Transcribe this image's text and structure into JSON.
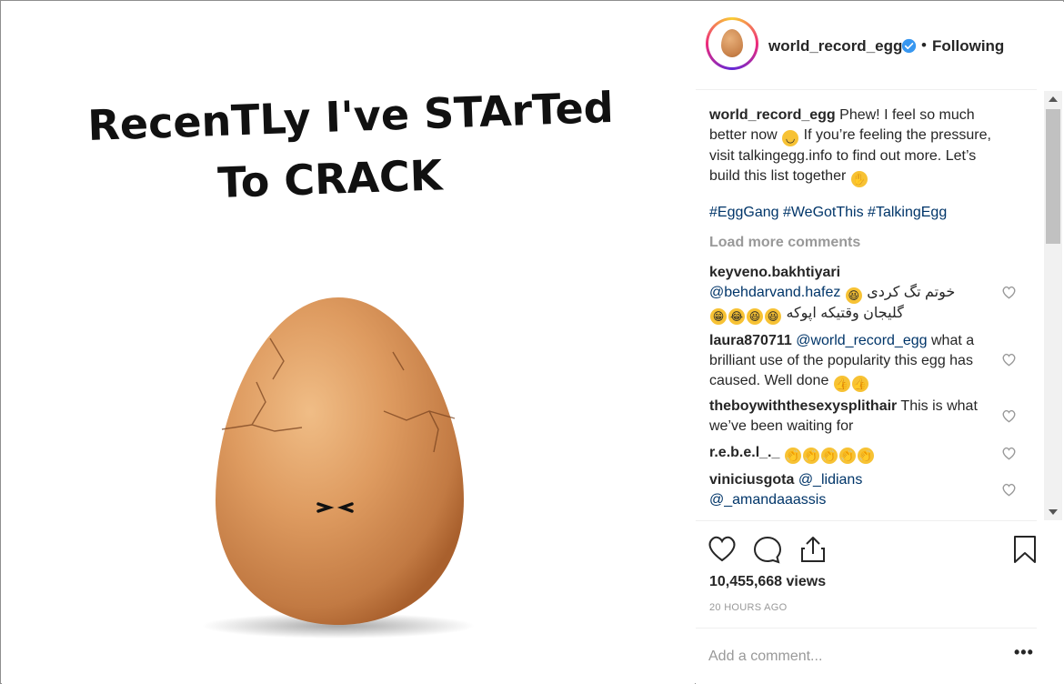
{
  "post": {
    "image_caption_line1": "RecenTLy I've STArTed",
    "image_caption_line2": "To CRACK"
  },
  "header": {
    "username": "world_record_egg",
    "verified_icon": "verified-badge-icon",
    "separator": "•",
    "follow_status": "Following"
  },
  "caption": {
    "username": "world_record_egg",
    "text_part1": "Phew! I feel so much better now",
    "text_part2": "If you’re feeling the pressure, visit talkingegg.info to find out more. Let’s build this list together",
    "hashtags": [
      "#EggGang",
      "#WeGotThis",
      "#TalkingEgg"
    ]
  },
  "load_more": "Load more comments",
  "comments": [
    {
      "username": "keyveno.bakhtiyari",
      "mention": "@behdarvand.hafez",
      "text": "خوتم تگ کردی",
      "text2": "گلیجان وقتیکه اپوکه"
    },
    {
      "username": "laura870711",
      "mention": "@world_record_egg",
      "text": "what a brilliant use of the popularity this egg has caused. Well done"
    },
    {
      "username": "theboywiththesexysplithair",
      "text": "This is what we’ve been waiting for"
    },
    {
      "username": "r.e.b.e.l_._"
    },
    {
      "username": "viniciusgota",
      "mention": "@_lidians",
      "mention2": "@_amandaaassis"
    }
  ],
  "actions": {
    "views": "10,455,668 views",
    "time_ago": "20 HOURS AGO"
  },
  "add_comment": {
    "placeholder": "Add a comment...",
    "more": "•••"
  },
  "colors": {
    "link": "#003569",
    "muted": "#999999",
    "text": "#262626",
    "verified": "#3897f0"
  }
}
